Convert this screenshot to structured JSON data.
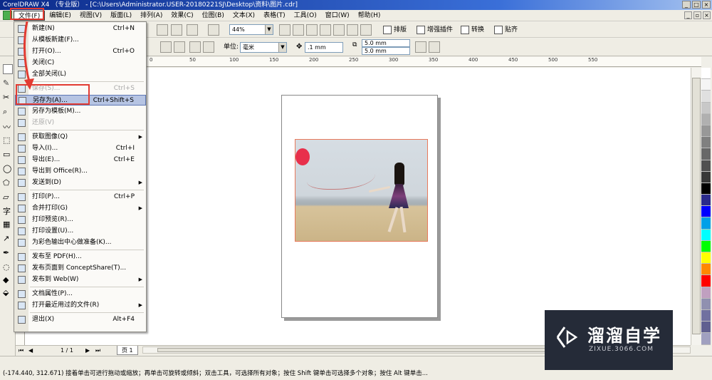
{
  "window": {
    "title": "CorelDRAW X4 （专业版） - [C:\\Users\\Administrator.USER-20180221SJ\\Desktop\\资料\\图片.cdr]",
    "controls": [
      "_",
      "□",
      "×"
    ]
  },
  "menubar": {
    "items": [
      "文件(F)",
      "编辑(E)",
      "视图(V)",
      "版面(L)",
      "排列(A)",
      "效果(C)",
      "位图(B)",
      "文本(X)",
      "表格(T)",
      "工具(O)",
      "窗口(W)",
      "帮助(H)"
    ],
    "active_index": 0
  },
  "toolbar1": {
    "zoom_value": "44%",
    "buttons": {
      "arrange": "排版",
      "enhance": "增强插件",
      "convert": "转换",
      "paste": "贴齐"
    }
  },
  "toolbar2": {
    "units_label": "单位:",
    "units_value": "毫米",
    "nudge_value": ".1 mm",
    "dup_x": "5.0 mm",
    "dup_y": "5.0 mm"
  },
  "ruler": {
    "h_ticks": [
      "150",
      "100",
      "50",
      "0",
      "50",
      "100",
      "150",
      "200",
      "250",
      "300",
      "350",
      "400",
      "450",
      "500",
      "550"
    ]
  },
  "file_menu": {
    "items": [
      {
        "label": "新建(N)",
        "shortcut": "Ctrl+N",
        "disabled": false,
        "submenu": false
      },
      {
        "label": "从模板新建(F)...",
        "shortcut": "",
        "disabled": false,
        "submenu": false
      },
      {
        "label": "打开(O)...",
        "shortcut": "Ctrl+O",
        "disabled": false,
        "submenu": false
      },
      {
        "label": "关闭(C)",
        "shortcut": "",
        "disabled": false,
        "submenu": false
      },
      {
        "label": "全部关闭(L)",
        "shortcut": "",
        "disabled": false,
        "submenu": false
      },
      {
        "label": "保存(S)...",
        "shortcut": "Ctrl+S",
        "disabled": true,
        "submenu": false
      },
      {
        "label": "另存为(A)...",
        "shortcut": "Ctrl+Shift+S",
        "disabled": false,
        "submenu": false
      },
      {
        "label": "另存为模板(M)...",
        "shortcut": "",
        "disabled": false,
        "submenu": false
      },
      {
        "label": "还原(V)",
        "shortcut": "",
        "disabled": true,
        "submenu": false
      },
      {
        "label": "获取图像(Q)",
        "shortcut": "",
        "disabled": false,
        "submenu": true
      },
      {
        "label": "导入(I)...",
        "shortcut": "Ctrl+I",
        "disabled": false,
        "submenu": false
      },
      {
        "label": "导出(E)...",
        "shortcut": "Ctrl+E",
        "disabled": false,
        "submenu": false
      },
      {
        "label": "导出到 Office(R)...",
        "shortcut": "",
        "disabled": false,
        "submenu": false
      },
      {
        "label": "发送到(D)",
        "shortcut": "",
        "disabled": false,
        "submenu": true
      },
      {
        "label": "打印(P)...",
        "shortcut": "Ctrl+P",
        "disabled": false,
        "submenu": false
      },
      {
        "label": "合并打印(G)",
        "shortcut": "",
        "disabled": false,
        "submenu": true
      },
      {
        "label": "打印预览(R)...",
        "shortcut": "",
        "disabled": false,
        "submenu": false
      },
      {
        "label": "打印设置(U)...",
        "shortcut": "",
        "disabled": false,
        "submenu": false
      },
      {
        "label": "为彩色输出中心做准备(K)...",
        "shortcut": "",
        "disabled": false,
        "submenu": false
      },
      {
        "label": "发布至 PDF(H)...",
        "shortcut": "",
        "disabled": false,
        "submenu": false
      },
      {
        "label": "发布页面到 ConceptShare(T)...",
        "shortcut": "",
        "disabled": false,
        "submenu": false
      },
      {
        "label": "发布到 Web(W)",
        "shortcut": "",
        "disabled": false,
        "submenu": true
      },
      {
        "label": "文档属性(P)...",
        "shortcut": "",
        "disabled": false,
        "submenu": false
      },
      {
        "label": "打开最近用过的文件(R)",
        "shortcut": "",
        "disabled": false,
        "submenu": true
      },
      {
        "label": "退出(X)",
        "shortcut": "Alt+F4",
        "disabled": false,
        "submenu": false
      }
    ],
    "highlighted_index": 6
  },
  "pagebar": {
    "page_count": "1 / 1",
    "page_tab": "页 1"
  },
  "status": {
    "text": "(-174.440, 312.671)  接着单击可进行拖动或缩放；再单击可旋转或倾斜；双击工具，可选择所有对象；按住 Shift 键单击可选择多个对象；按住 Alt 键单击..."
  },
  "palette": [
    "#ffffff",
    "#f5f5f5",
    "#e0e0e0",
    "#c8c8c8",
    "#b0b0b0",
    "#989898",
    "#808080",
    "#686868",
    "#505050",
    "#383838",
    "#000000",
    "#2a2a8c",
    "#0000ff",
    "#00a0e8",
    "#00ffff",
    "#00ff00",
    "#ffff00",
    "#ff8800",
    "#ff0000",
    "#c0a0c0",
    "#9090b0",
    "#7070a0",
    "#606090",
    "#a0a0c0"
  ],
  "watermark": {
    "title": "溜溜自学",
    "url": "ZIXUE.3066.COM"
  }
}
